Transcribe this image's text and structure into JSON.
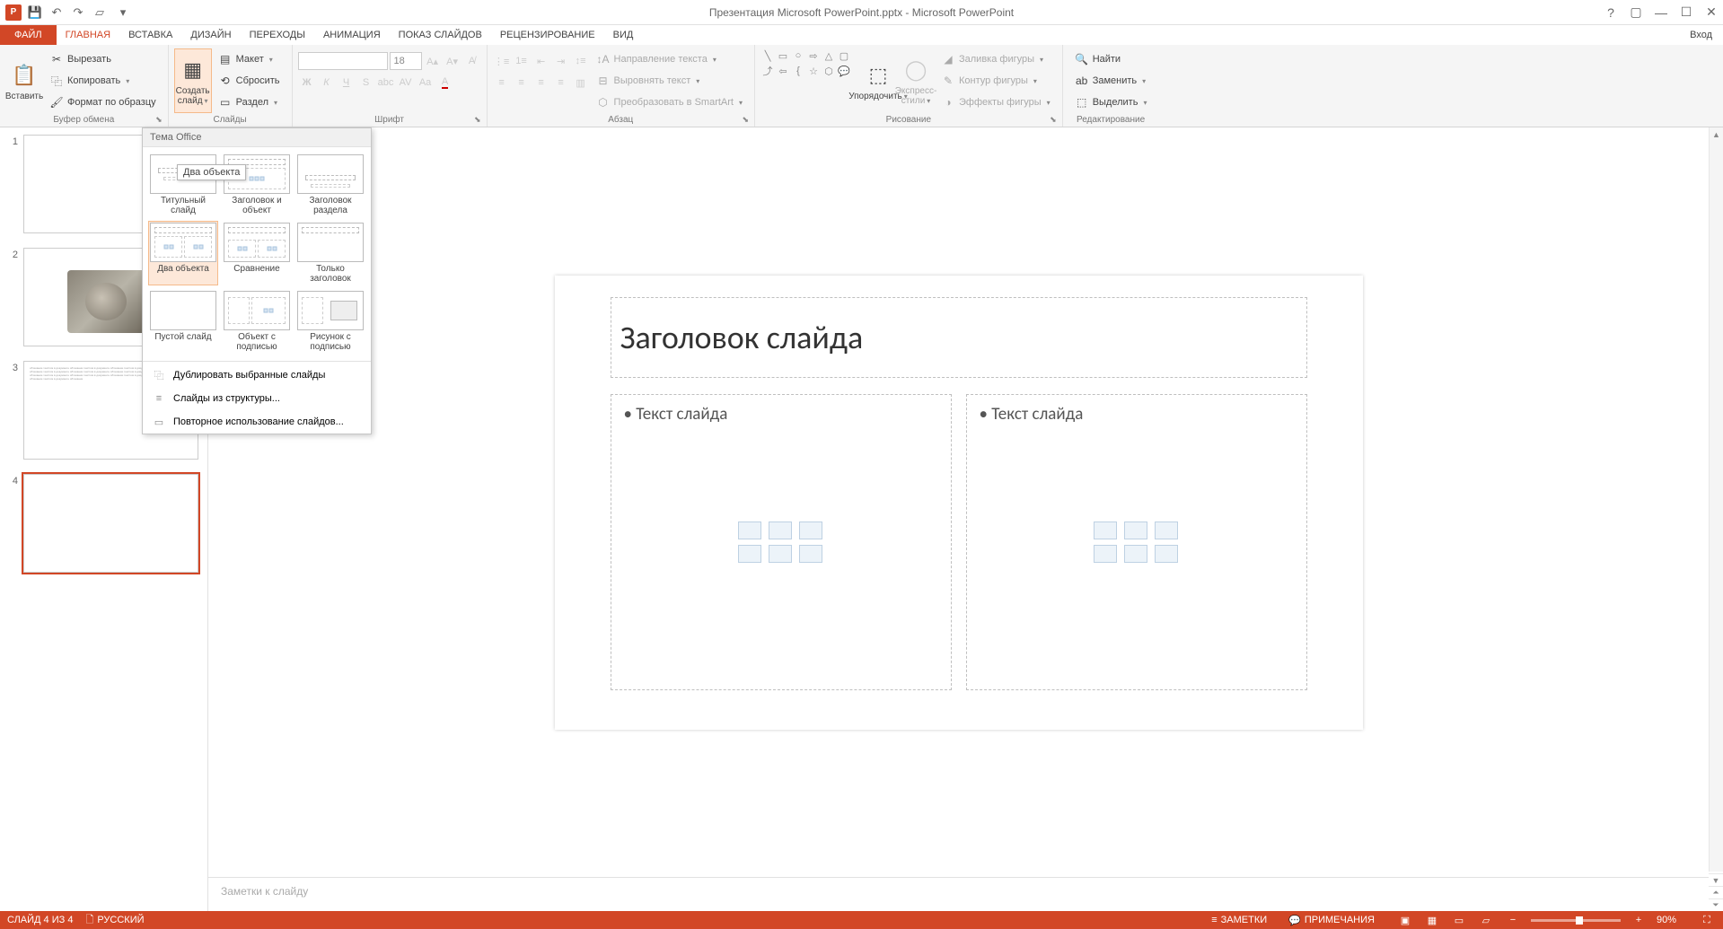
{
  "title": "Презентация Microsoft PowerPoint.pptx - Microsoft PowerPoint",
  "account": "Вход",
  "tabs": {
    "file": "ФАЙЛ",
    "list": [
      "ГЛАВНАЯ",
      "ВСТАВКА",
      "ДИЗАЙН",
      "ПЕРЕХОДЫ",
      "АНИМАЦИЯ",
      "ПОКАЗ СЛАЙДОВ",
      "РЕЦЕНЗИРОВАНИЕ",
      "ВИД"
    ]
  },
  "ribbon": {
    "clipboard": {
      "paste": "Вставить",
      "cut": "Вырезать",
      "copy": "Копировать",
      "format_painter": "Формат по образцу",
      "label": "Буфер обмена"
    },
    "slides": {
      "new_slide": "Создать слайд",
      "layout": "Макет",
      "reset": "Сбросить",
      "section": "Раздел",
      "label": "Слайды"
    },
    "font": {
      "size": "18",
      "label": "Шрифт"
    },
    "paragraph": {
      "text_direction": "Направление текста",
      "align_text": "Выровнять текст",
      "smartart": "Преобразовать в SmartArt",
      "label": "Абзац"
    },
    "drawing": {
      "arrange": "Упорядочить",
      "quick_styles": "Экспресс-стили",
      "shape_fill": "Заливка фигуры",
      "shape_outline": "Контур фигуры",
      "shape_effects": "Эффекты фигуры",
      "label": "Рисование"
    },
    "editing": {
      "find": "Найти",
      "replace": "Заменить",
      "select": "Выделить",
      "label": "Редактирование"
    }
  },
  "layout_gallery": {
    "header": "Тема Office",
    "items": [
      "Титульный слайд",
      "Заголовок и объект",
      "Заголовок раздела",
      "Два объекта",
      "Сравнение",
      "Только заголовок",
      "Пустой слайд",
      "Объект с подписью",
      "Рисунок с подписью"
    ],
    "tooltip": "Два объекта",
    "menu": [
      "Дублировать выбранные слайды",
      "Слайды из структуры...",
      "Повторное использование слайдов..."
    ]
  },
  "thumbnails": {
    "count": 4,
    "selected": 4
  },
  "slide": {
    "title": "Заголовок слайда",
    "body_left": "• Текст слайда",
    "body_right": "• Текст слайда"
  },
  "notes_placeholder": "Заметки к слайду",
  "statusbar": {
    "slide_info": "СЛАЙД 4 ИЗ 4",
    "language": "РУССКИЙ",
    "notes": "ЗАМЕТКИ",
    "comments": "ПРИМЕЧАНИЯ",
    "zoom": "90%"
  }
}
